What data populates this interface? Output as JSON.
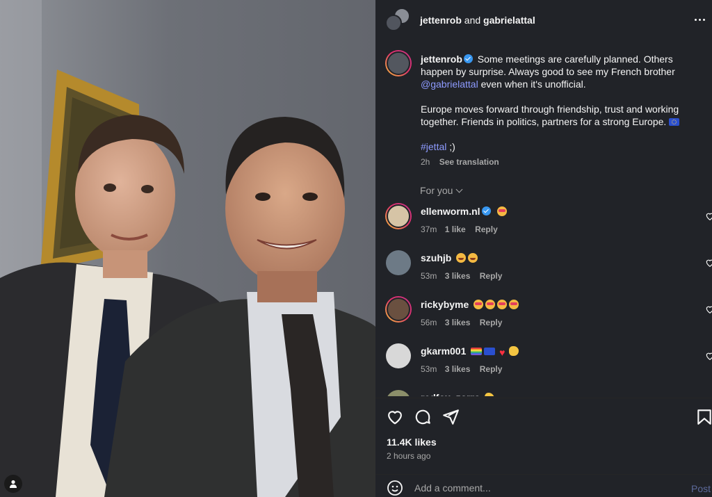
{
  "header": {
    "user1": "jettenrob",
    "joiner": "and",
    "user2": "gabrielattal"
  },
  "caption": {
    "username": "jettenrob",
    "text1": "Some meetings are carefully planned. Others happen by surprise. Always good to see my French brother",
    "mention": "@gabrielattal",
    "text2": "even when it's unofficial.",
    "text3": "Europe moves forward through friendship, trust and working together. Friends in politics, partners for a strong Europe.",
    "hashtag": "#jettal",
    "hashtag_suffix": ";)",
    "time": "2h",
    "see_translation": "See translation"
  },
  "filter": {
    "label": "For you"
  },
  "comments": [
    {
      "username": "ellenworm.nl",
      "verified": true,
      "time": "37m",
      "likes": "1 like",
      "reply": "Reply",
      "emojis": [
        "star-struck"
      ]
    },
    {
      "username": "szuhjb",
      "verified": false,
      "time": "53m",
      "likes": "3 likes",
      "reply": "Reply",
      "emojis": [
        "smiling-face-with-hearts",
        "smiling-face-with-hearts"
      ]
    },
    {
      "username": "rickybyme",
      "verified": false,
      "time": "56m",
      "likes": "3 likes",
      "reply": "Reply",
      "emojis": [
        "star-struck",
        "star-struck",
        "star-struck",
        "star-struck"
      ]
    },
    {
      "username": "gkarm001",
      "verified": false,
      "time": "53m",
      "likes": "3 likes",
      "reply": "Reply",
      "emojis": [
        "rainbow-flag",
        "eu-flag",
        "red-heart",
        "clapping-hands"
      ]
    },
    {
      "username": "redfox_zorro",
      "verified": false,
      "time": "",
      "likes": "",
      "reply": "",
      "emojis": [
        "flexed-biceps"
      ]
    }
  ],
  "actions": {
    "likes": "11.4K likes",
    "posted": "2 hours ago"
  },
  "composer": {
    "placeholder": "Add a comment...",
    "post_label": "Post"
  },
  "colors": {
    "panel": "#212328",
    "text": "#f5f5f5",
    "muted": "#a8a8a8",
    "link": "#8e9bff",
    "verified": "#3897f0"
  }
}
